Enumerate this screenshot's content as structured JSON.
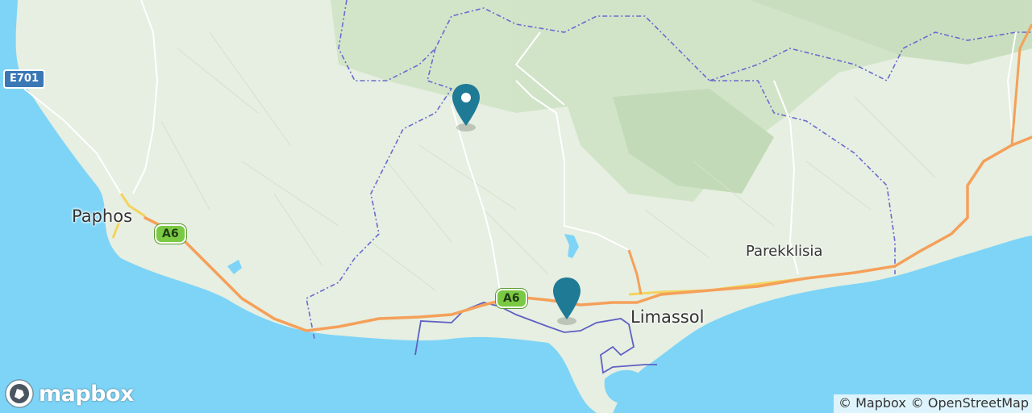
{
  "map": {
    "places": {
      "paphos": "Paphos",
      "limassol": "Limassol",
      "parekklisia": "Parekklisia"
    },
    "road_shields": {
      "e701": "E701",
      "a6_west": "A6",
      "a6_east": "A6"
    },
    "markers": [
      {
        "name": "map-marker-1",
        "color": "#1f7a95"
      },
      {
        "name": "map-marker-2",
        "color": "#1f7a95"
      }
    ],
    "colors": {
      "sea": "#7ed4f7",
      "land": "#e6efe1",
      "motorway": "#f5a05a",
      "primary_road": "#f4d35e",
      "boundary": "#6a6ad0",
      "marker": "#1f7a95"
    }
  },
  "logo": {
    "text": "mapbox"
  },
  "attribution": {
    "mapbox": "© Mapbox",
    "osm": "© OpenStreetMap"
  }
}
